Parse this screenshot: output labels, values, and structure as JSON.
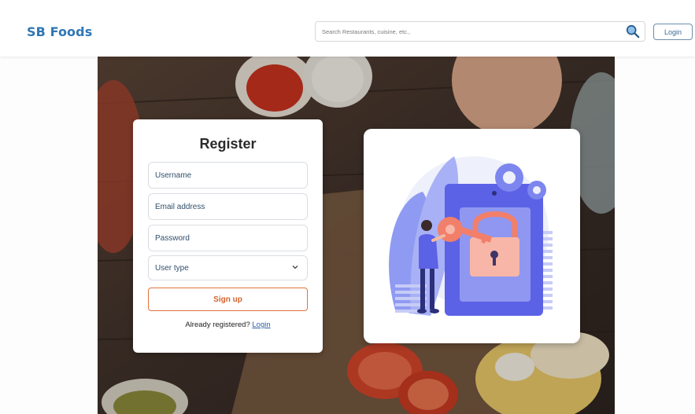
{
  "header": {
    "brand": "SB Foods",
    "search_placeholder": "Search Restaurants, cuisine, etc.,",
    "login_label": "Login"
  },
  "register": {
    "title": "Register",
    "username_placeholder": "Username",
    "email_placeholder": "Email address",
    "password_placeholder": "Password",
    "user_type_label": "User type",
    "signup_label": "Sign up",
    "already_text": "Already registered?",
    "login_link": "Login"
  },
  "colors": {
    "brand": "#2f77b5",
    "signup_accent": "#e0723d",
    "illustration_primary": "#5b62e6",
    "key_color": "#f27f6a"
  },
  "icons": [
    "search-icon",
    "chevron-down-icon",
    "lock-icon",
    "key-icon",
    "gear-icon"
  ]
}
